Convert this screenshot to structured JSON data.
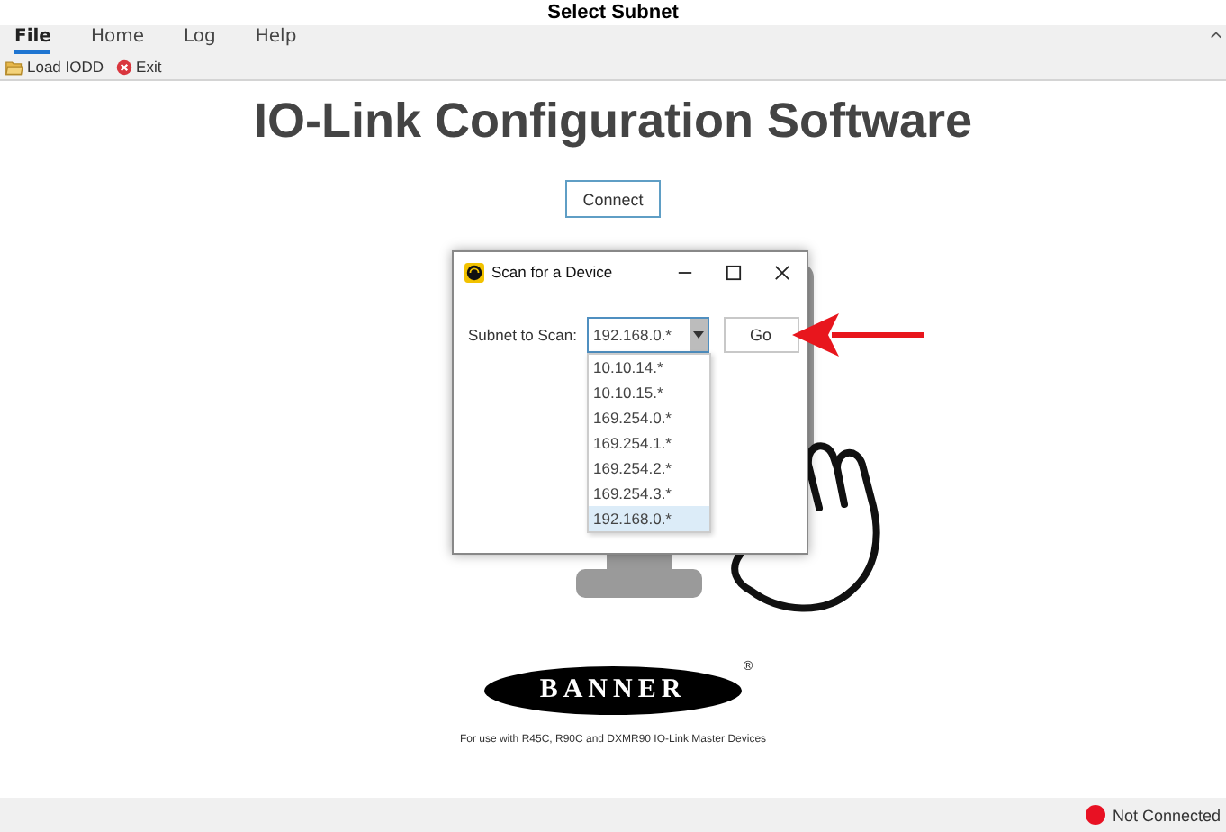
{
  "caption": "Select Subnet",
  "menu": [
    {
      "label": "File",
      "selected": true
    },
    {
      "label": "Home",
      "selected": false
    },
    {
      "label": "Log",
      "selected": false
    },
    {
      "label": "Help",
      "selected": false
    }
  ],
  "toolbar": [
    {
      "kind": "load",
      "label": "Load IODD"
    },
    {
      "kind": "exit",
      "label": "Exit"
    }
  ],
  "title": "IO-Link Configuration Software",
  "connect_button": "Connect",
  "dialog": {
    "title": "Scan for a Device",
    "subnet_label": "Subnet to Scan:",
    "subnet_value": "192.168.0.*",
    "go_button": "Go",
    "options": [
      {
        "label": "10.10.14.*",
        "selected": false
      },
      {
        "label": "10.10.15.*",
        "selected": false
      },
      {
        "label": "169.254.0.*",
        "selected": false
      },
      {
        "label": "169.254.1.*",
        "selected": false
      },
      {
        "label": "169.254.2.*",
        "selected": false
      },
      {
        "label": "169.254.3.*",
        "selected": false
      },
      {
        "label": "192.168.0.*",
        "selected": true
      }
    ]
  },
  "logo": {
    "text": "BANNER",
    "mark": "®"
  },
  "footnote": "For use with R45C, R90C and DXMR90 IO-Link Master Devices",
  "status": {
    "text": "Not Connected",
    "color": "#e81123"
  }
}
